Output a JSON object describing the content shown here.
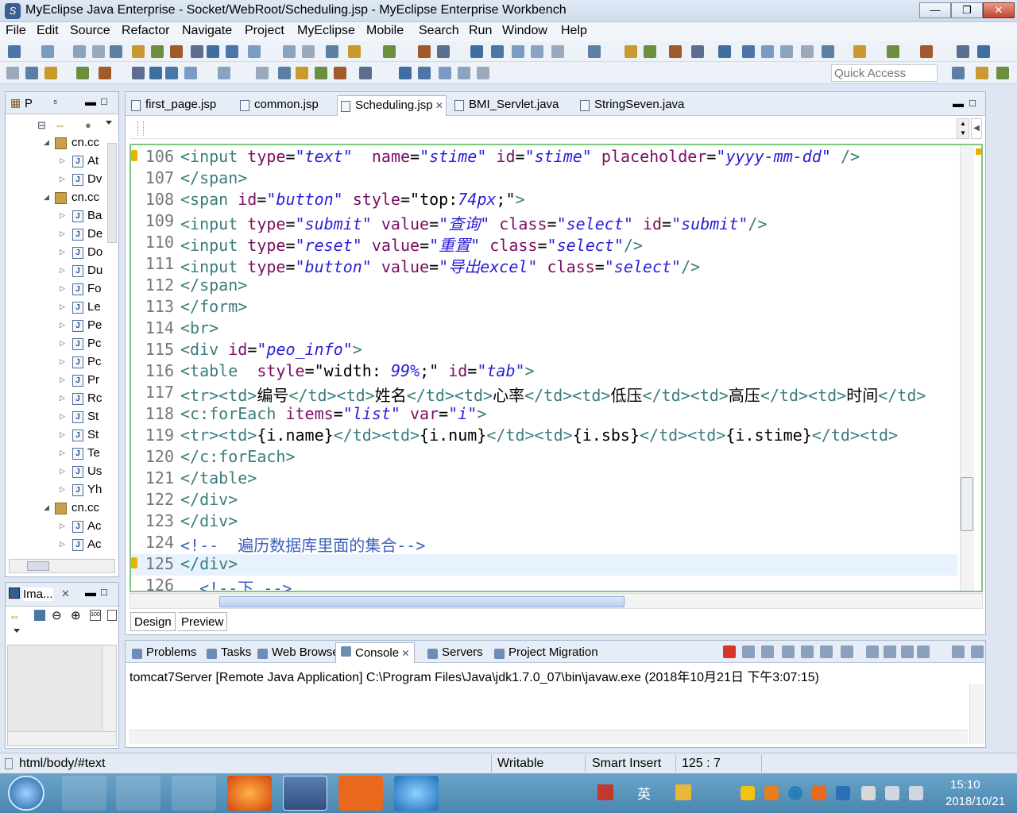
{
  "window": {
    "title": "MyEclipse Java Enterprise - Socket/WebRoot/Scheduling.jsp - MyEclipse Enterprise Workbench",
    "app_icon_label": "S",
    "minimize": "—",
    "maximize": "❐",
    "close": "✕"
  },
  "menu": [
    "File",
    "Edit",
    "Source",
    "Refactor",
    "Navigate",
    "Project",
    "MyEclipse",
    "Mobile",
    "Search",
    "Run",
    "Window",
    "Help"
  ],
  "toolbar": {
    "quick_access_placeholder": "Quick Access"
  },
  "package_explorer": {
    "tab_label": "P",
    "tab_second": "⁵",
    "rows": [
      {
        "kind": "pkg",
        "label": "cn.cc",
        "open": true
      },
      {
        "kind": "file",
        "label": "At"
      },
      {
        "kind": "file",
        "label": "Dv"
      },
      {
        "kind": "pkg",
        "label": "cn.cc",
        "open": true
      },
      {
        "kind": "file",
        "label": "Ba"
      },
      {
        "kind": "file",
        "label": "De"
      },
      {
        "kind": "file",
        "label": "Do"
      },
      {
        "kind": "file",
        "label": "Du"
      },
      {
        "kind": "file",
        "label": "Fo"
      },
      {
        "kind": "file",
        "label": "Le"
      },
      {
        "kind": "file",
        "label": "Pe"
      },
      {
        "kind": "file",
        "label": "Pc"
      },
      {
        "kind": "file",
        "label": "Pc"
      },
      {
        "kind": "file",
        "label": "Pr"
      },
      {
        "kind": "file",
        "label": "Rc"
      },
      {
        "kind": "file",
        "label": "St"
      },
      {
        "kind": "file",
        "label": "St"
      },
      {
        "kind": "file",
        "label": "Te"
      },
      {
        "kind": "file",
        "label": "Us"
      },
      {
        "kind": "file",
        "label": "Yh"
      },
      {
        "kind": "pkg",
        "label": "cn.cc",
        "open": true
      },
      {
        "kind": "file",
        "label": "Ac"
      },
      {
        "kind": "file",
        "label": "Ac"
      }
    ]
  },
  "image_panel": {
    "tab_label": "Ima..."
  },
  "editor": {
    "tabs": [
      "first_page.jsp",
      "common.jsp",
      "Scheduling.jsp",
      "BMI_Servlet.java",
      "StringSeven.java"
    ],
    "active_tab": "Scheduling.jsp",
    "lines": [
      {
        "n": "106",
        "parts": [
          [
            "tg",
            "<input "
          ],
          [
            "an",
            "type"
          ],
          [
            "tx",
            "="
          ],
          [
            "av",
            "\"text\""
          ],
          [
            "tx",
            "  "
          ],
          [
            "an",
            "name"
          ],
          [
            "tx",
            "="
          ],
          [
            "av",
            "\"stime\""
          ],
          [
            "tx",
            " "
          ],
          [
            "an",
            "id"
          ],
          [
            "tx",
            "="
          ],
          [
            "av",
            "\"stime\""
          ],
          [
            "tx",
            " "
          ],
          [
            "an",
            "placeholder"
          ],
          [
            "tx",
            "="
          ],
          [
            "av",
            "\"yyyy-mm-dd\""
          ],
          [
            "tg",
            " />"
          ]
        ]
      },
      {
        "n": "107",
        "parts": [
          [
            "tg",
            "</span>"
          ]
        ]
      },
      {
        "n": "108",
        "parts": [
          [
            "tg",
            "<span "
          ],
          [
            "an",
            "id"
          ],
          [
            "tx",
            "="
          ],
          [
            "av",
            "\"button\""
          ],
          [
            "tx",
            " "
          ],
          [
            "an",
            "style"
          ],
          [
            "tx",
            "=\""
          ],
          [
            "tx",
            "top:"
          ],
          [
            "av",
            "74px"
          ],
          [
            "tx",
            ";\""
          ],
          [
            "tg",
            ">"
          ]
        ]
      },
      {
        "n": "109",
        "parts": [
          [
            "tg",
            "<input "
          ],
          [
            "an",
            "type"
          ],
          [
            "tx",
            "="
          ],
          [
            "av",
            "\"submit\""
          ],
          [
            "tx",
            " "
          ],
          [
            "an",
            "value"
          ],
          [
            "tx",
            "="
          ],
          [
            "av",
            "\"查询\""
          ],
          [
            "tx",
            " "
          ],
          [
            "an",
            "class"
          ],
          [
            "tx",
            "="
          ],
          [
            "av",
            "\"select\""
          ],
          [
            "tx",
            " "
          ],
          [
            "an",
            "id"
          ],
          [
            "tx",
            "="
          ],
          [
            "av",
            "\"submit\""
          ],
          [
            "tg",
            "/>"
          ]
        ]
      },
      {
        "n": "110",
        "parts": [
          [
            "tg",
            "<input "
          ],
          [
            "an",
            "type"
          ],
          [
            "tx",
            "="
          ],
          [
            "av",
            "\"reset\""
          ],
          [
            "tx",
            " "
          ],
          [
            "an",
            "value"
          ],
          [
            "tx",
            "="
          ],
          [
            "av",
            "\"重置\""
          ],
          [
            "tx",
            " "
          ],
          [
            "an",
            "class"
          ],
          [
            "tx",
            "="
          ],
          [
            "av",
            "\"select\""
          ],
          [
            "tg",
            "/>"
          ]
        ]
      },
      {
        "n": "111",
        "parts": [
          [
            "tg",
            "<input "
          ],
          [
            "an",
            "type"
          ],
          [
            "tx",
            "="
          ],
          [
            "av",
            "\"button\""
          ],
          [
            "tx",
            " "
          ],
          [
            "an",
            "value"
          ],
          [
            "tx",
            "="
          ],
          [
            "av",
            "\"导出excel\""
          ],
          [
            "tx",
            " "
          ],
          [
            "an",
            "class"
          ],
          [
            "tx",
            "="
          ],
          [
            "av",
            "\"select\""
          ],
          [
            "tg",
            "/>"
          ]
        ]
      },
      {
        "n": "112",
        "parts": [
          [
            "tg",
            "</span>"
          ]
        ]
      },
      {
        "n": "113",
        "parts": [
          [
            "tg",
            "</form>"
          ]
        ]
      },
      {
        "n": "114",
        "parts": [
          [
            "tg",
            "<br>"
          ]
        ]
      },
      {
        "n": "115",
        "parts": [
          [
            "tg",
            "<div "
          ],
          [
            "an",
            "id"
          ],
          [
            "tx",
            "="
          ],
          [
            "av",
            "\"peo_info\""
          ],
          [
            "tg",
            ">"
          ]
        ]
      },
      {
        "n": "116",
        "parts": [
          [
            "tg",
            "<table "
          ],
          [
            "tx",
            " "
          ],
          [
            "an",
            "style"
          ],
          [
            "tx",
            "=\"width: "
          ],
          [
            "av",
            "99%"
          ],
          [
            "tx",
            ";\" "
          ],
          [
            "an",
            "id"
          ],
          [
            "tx",
            "="
          ],
          [
            "av",
            "\"tab\""
          ],
          [
            "tg",
            ">"
          ]
        ]
      },
      {
        "n": "117",
        "parts": [
          [
            "tg",
            "<tr><td>"
          ],
          [
            "tx",
            "编号"
          ],
          [
            "tg",
            "</td><td>"
          ],
          [
            "tx",
            "姓名"
          ],
          [
            "tg",
            "</td><td>"
          ],
          [
            "tx",
            "心率"
          ],
          [
            "tg",
            "</td><td>"
          ],
          [
            "tx",
            "低压"
          ],
          [
            "tg",
            "</td><td>"
          ],
          [
            "tx",
            "高压"
          ],
          [
            "tg",
            "</td><td>"
          ],
          [
            "tx",
            "时间"
          ],
          [
            "tg",
            "</td>"
          ]
        ]
      },
      {
        "n": "118",
        "parts": [
          [
            "tg",
            "<c:forEach "
          ],
          [
            "an",
            "items"
          ],
          [
            "tx",
            "="
          ],
          [
            "av",
            "\"list\""
          ],
          [
            "tx",
            " "
          ],
          [
            "an",
            "var"
          ],
          [
            "tx",
            "="
          ],
          [
            "av",
            "\"i\""
          ],
          [
            "tg",
            ">"
          ]
        ]
      },
      {
        "n": "119",
        "parts": [
          [
            "tg",
            "<tr><td>"
          ],
          [
            "tx",
            "{i.name}"
          ],
          [
            "tg",
            "</td><td>"
          ],
          [
            "tx",
            "{i.num}"
          ],
          [
            "tg",
            "</td><td>"
          ],
          [
            "tx",
            "{i.sbs}"
          ],
          [
            "tg",
            "</td><td>"
          ],
          [
            "tx",
            "{i.stime}"
          ],
          [
            "tg",
            "</td><td>"
          ]
        ]
      },
      {
        "n": "120",
        "parts": [
          [
            "tg",
            "</c:forEach>"
          ]
        ]
      },
      {
        "n": "121",
        "parts": [
          [
            "tg",
            "</table>"
          ]
        ]
      },
      {
        "n": "122",
        "parts": [
          [
            "tg",
            "</div>"
          ]
        ]
      },
      {
        "n": "123",
        "parts": [
          [
            "tg",
            "</div>"
          ]
        ]
      },
      {
        "n": "124",
        "parts": [
          [
            "cm",
            "<!--  遍历数据库里面的集合-->"
          ]
        ]
      },
      {
        "n": "125",
        "parts": [
          [
            "tg",
            "</div>"
          ]
        ]
      },
      {
        "n": "126",
        "parts": [
          [
            "cm",
            "  <!--下 -->"
          ]
        ]
      }
    ],
    "design_tab": "Design",
    "preview_tab": "Preview"
  },
  "bottom_panel": {
    "tabs": [
      "Problems",
      "Tasks",
      "Web Browser",
      "Console",
      "Servers",
      "Project Migration"
    ],
    "active_tab": "Console",
    "console_line": "tomcat7Server [Remote Java Application] C:\\Program Files\\Java\\jdk1.7.0_07\\bin\\javaw.exe (2018年10月21日 下午3:07:15)"
  },
  "status_bar": {
    "path": "html/body/#text",
    "writable": "Writable",
    "insert_mode": "Smart Insert",
    "position": "125 : 7"
  },
  "taskbar": {
    "ime_label": "英",
    "time": "15:10",
    "date": "2018/10/21"
  }
}
